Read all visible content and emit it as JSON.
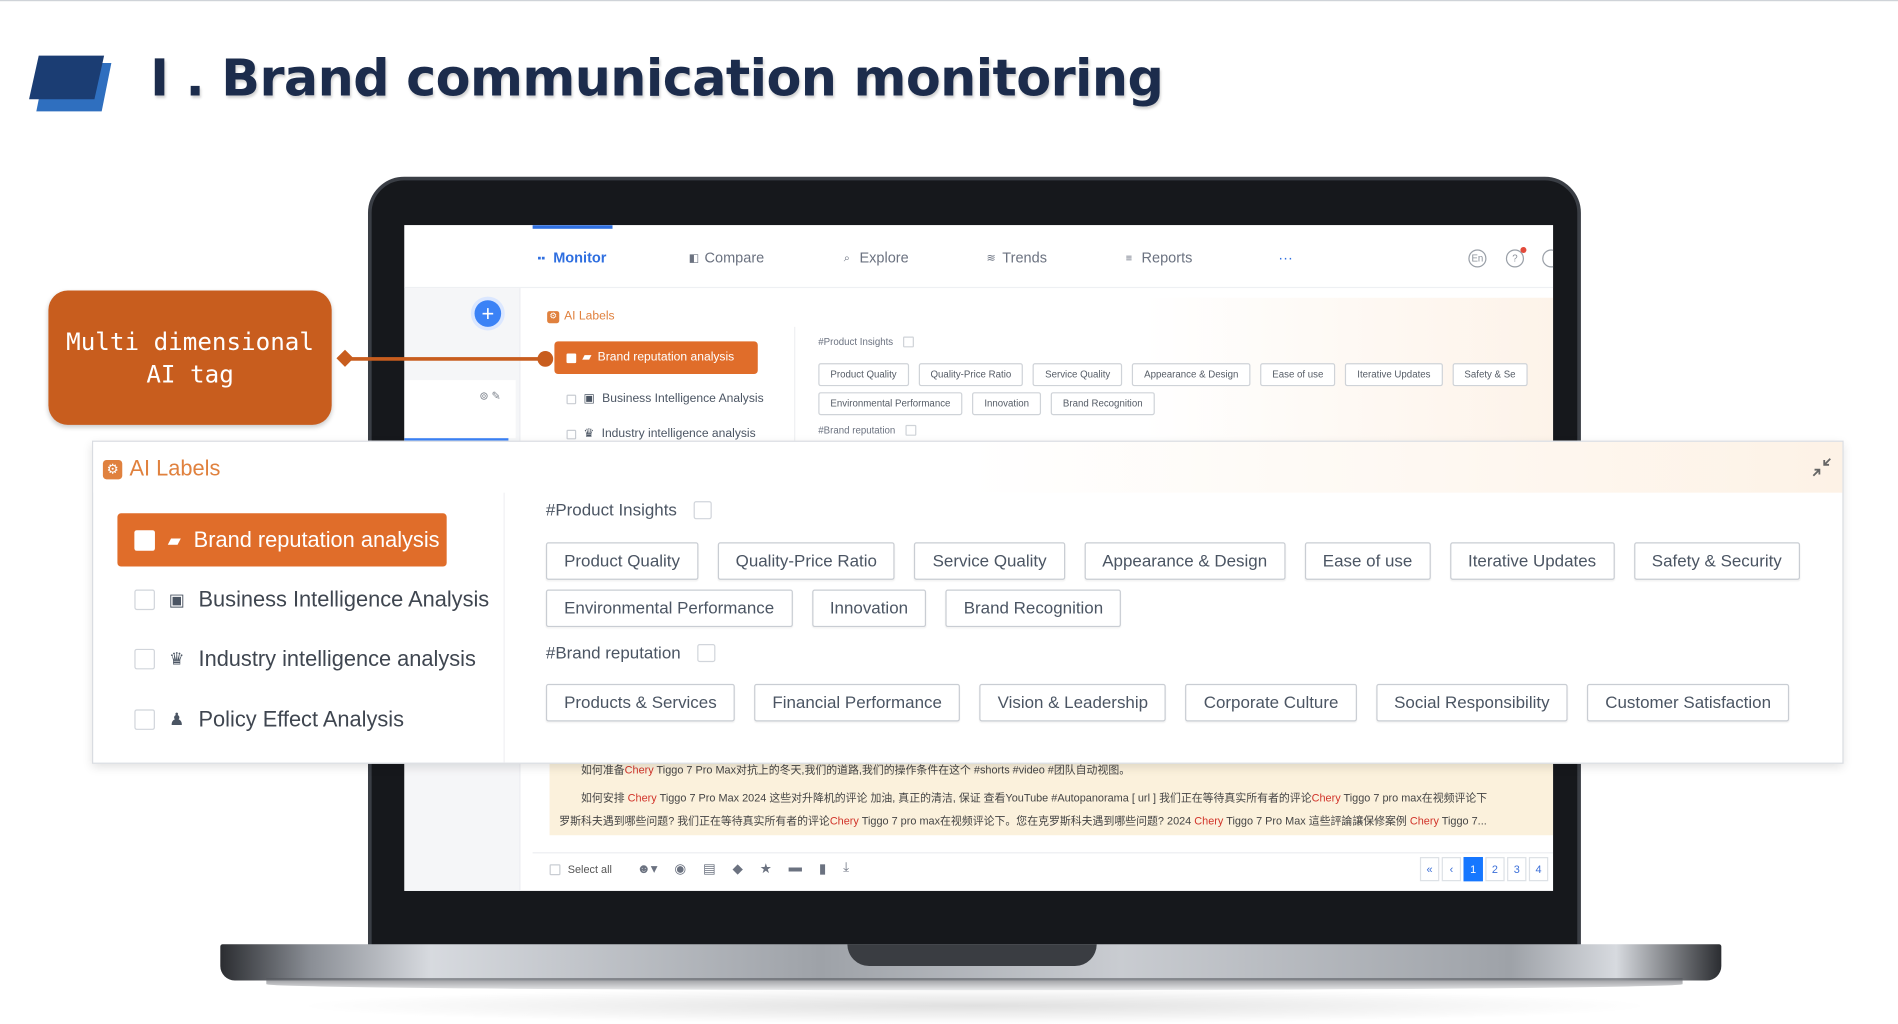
{
  "heading": "I . Brand communication monitoring",
  "callout": {
    "line1": "Multi dimensional",
    "line2": "AI tag"
  },
  "app": {
    "nav": {
      "monitor": "Monitor",
      "compare": "Compare",
      "explore": "Explore",
      "trends": "Trends",
      "reports": "Reports",
      "more": "···",
      "lang": "En",
      "help": "?"
    },
    "panel": {
      "title": "AI Labels",
      "categories": [
        "Brand reputation analysis",
        "Business Intelligence Analysis",
        "Industry intelligence analysis"
      ],
      "product_section": "#Product Insights",
      "product_tags": [
        "Product Quality",
        "Quality-Price Ratio",
        "Service Quality",
        "Appearance & Design",
        "Ease of use",
        "Iterative Updates",
        "Safety & Se"
      ],
      "product_tags_row2": [
        "Environmental Performance",
        "Innovation",
        "Brand Recognition"
      ],
      "brand_section": "#Brand reputation"
    },
    "content": {
      "line1_a": "如何准备",
      "line1_hl": "Chery",
      "line1_b": " Tiggo 7 Pro Max对抗上的冬天,我们的道路,我们的操作条件在这个 #shorts #video #团队自动视图。",
      "line2_a": "如何安排 ",
      "line2_hl": "Chery",
      "line2_b": " Tiggo 7 Pro Max 2024 这些对升降机的评论 加油, 真正的清洁, 保证 查看YouTube #Autopanorama [ url ] 我们正在等待真实所有者的评论",
      "line2_hl2": "Chery",
      "line2_c": " Tiggo 7 pro max在视频评论下",
      "line3_a": "罗斯科夫遇到哪些问题? 我们正在等待真实所有者的评论",
      "line3_hl": "Chery",
      "line3_b": " Tiggo 7 pro max在视频评论下。您在克罗斯科夫遇到哪些问题? 2024 ",
      "line3_hl2": "Chery",
      "line3_c": " Tiggo 7 Pro Max 這些評論讓保修案例 ",
      "line3_hl3": "Chery",
      "line3_d": " Tiggo 7..."
    },
    "toolbar": {
      "select_all": "Select all"
    },
    "pager": [
      "«",
      "‹",
      "1",
      "2",
      "3",
      "4"
    ]
  },
  "zoom": {
    "title": "AI Labels",
    "categories": [
      "Brand reputation analysis",
      "Business Intelligence Analysis",
      "Industry intelligence analysis",
      "Policy Effect Analysis"
    ],
    "product_section": "#Product Insights",
    "product_tags": [
      "Product Quality",
      "Quality-Price Ratio",
      "Service Quality",
      "Appearance & Design",
      "Ease of use",
      "Iterative Updates",
      "Safety & Security"
    ],
    "product_tags_row2": [
      "Environmental Performance",
      "Innovation",
      "Brand Recognition"
    ],
    "brand_section": "#Brand reputation",
    "brand_tags": [
      "Products & Services",
      "Financial Performance",
      "Vision & Leadership",
      "Corporate Culture",
      "Social Responsibility",
      "Customer Satisfaction"
    ]
  },
  "colors": {
    "accent_orange": "#c85d1e",
    "active_orange": "#e06d2a",
    "nav_blue": "#2f6fe0",
    "heading": "#1c2c4c"
  }
}
